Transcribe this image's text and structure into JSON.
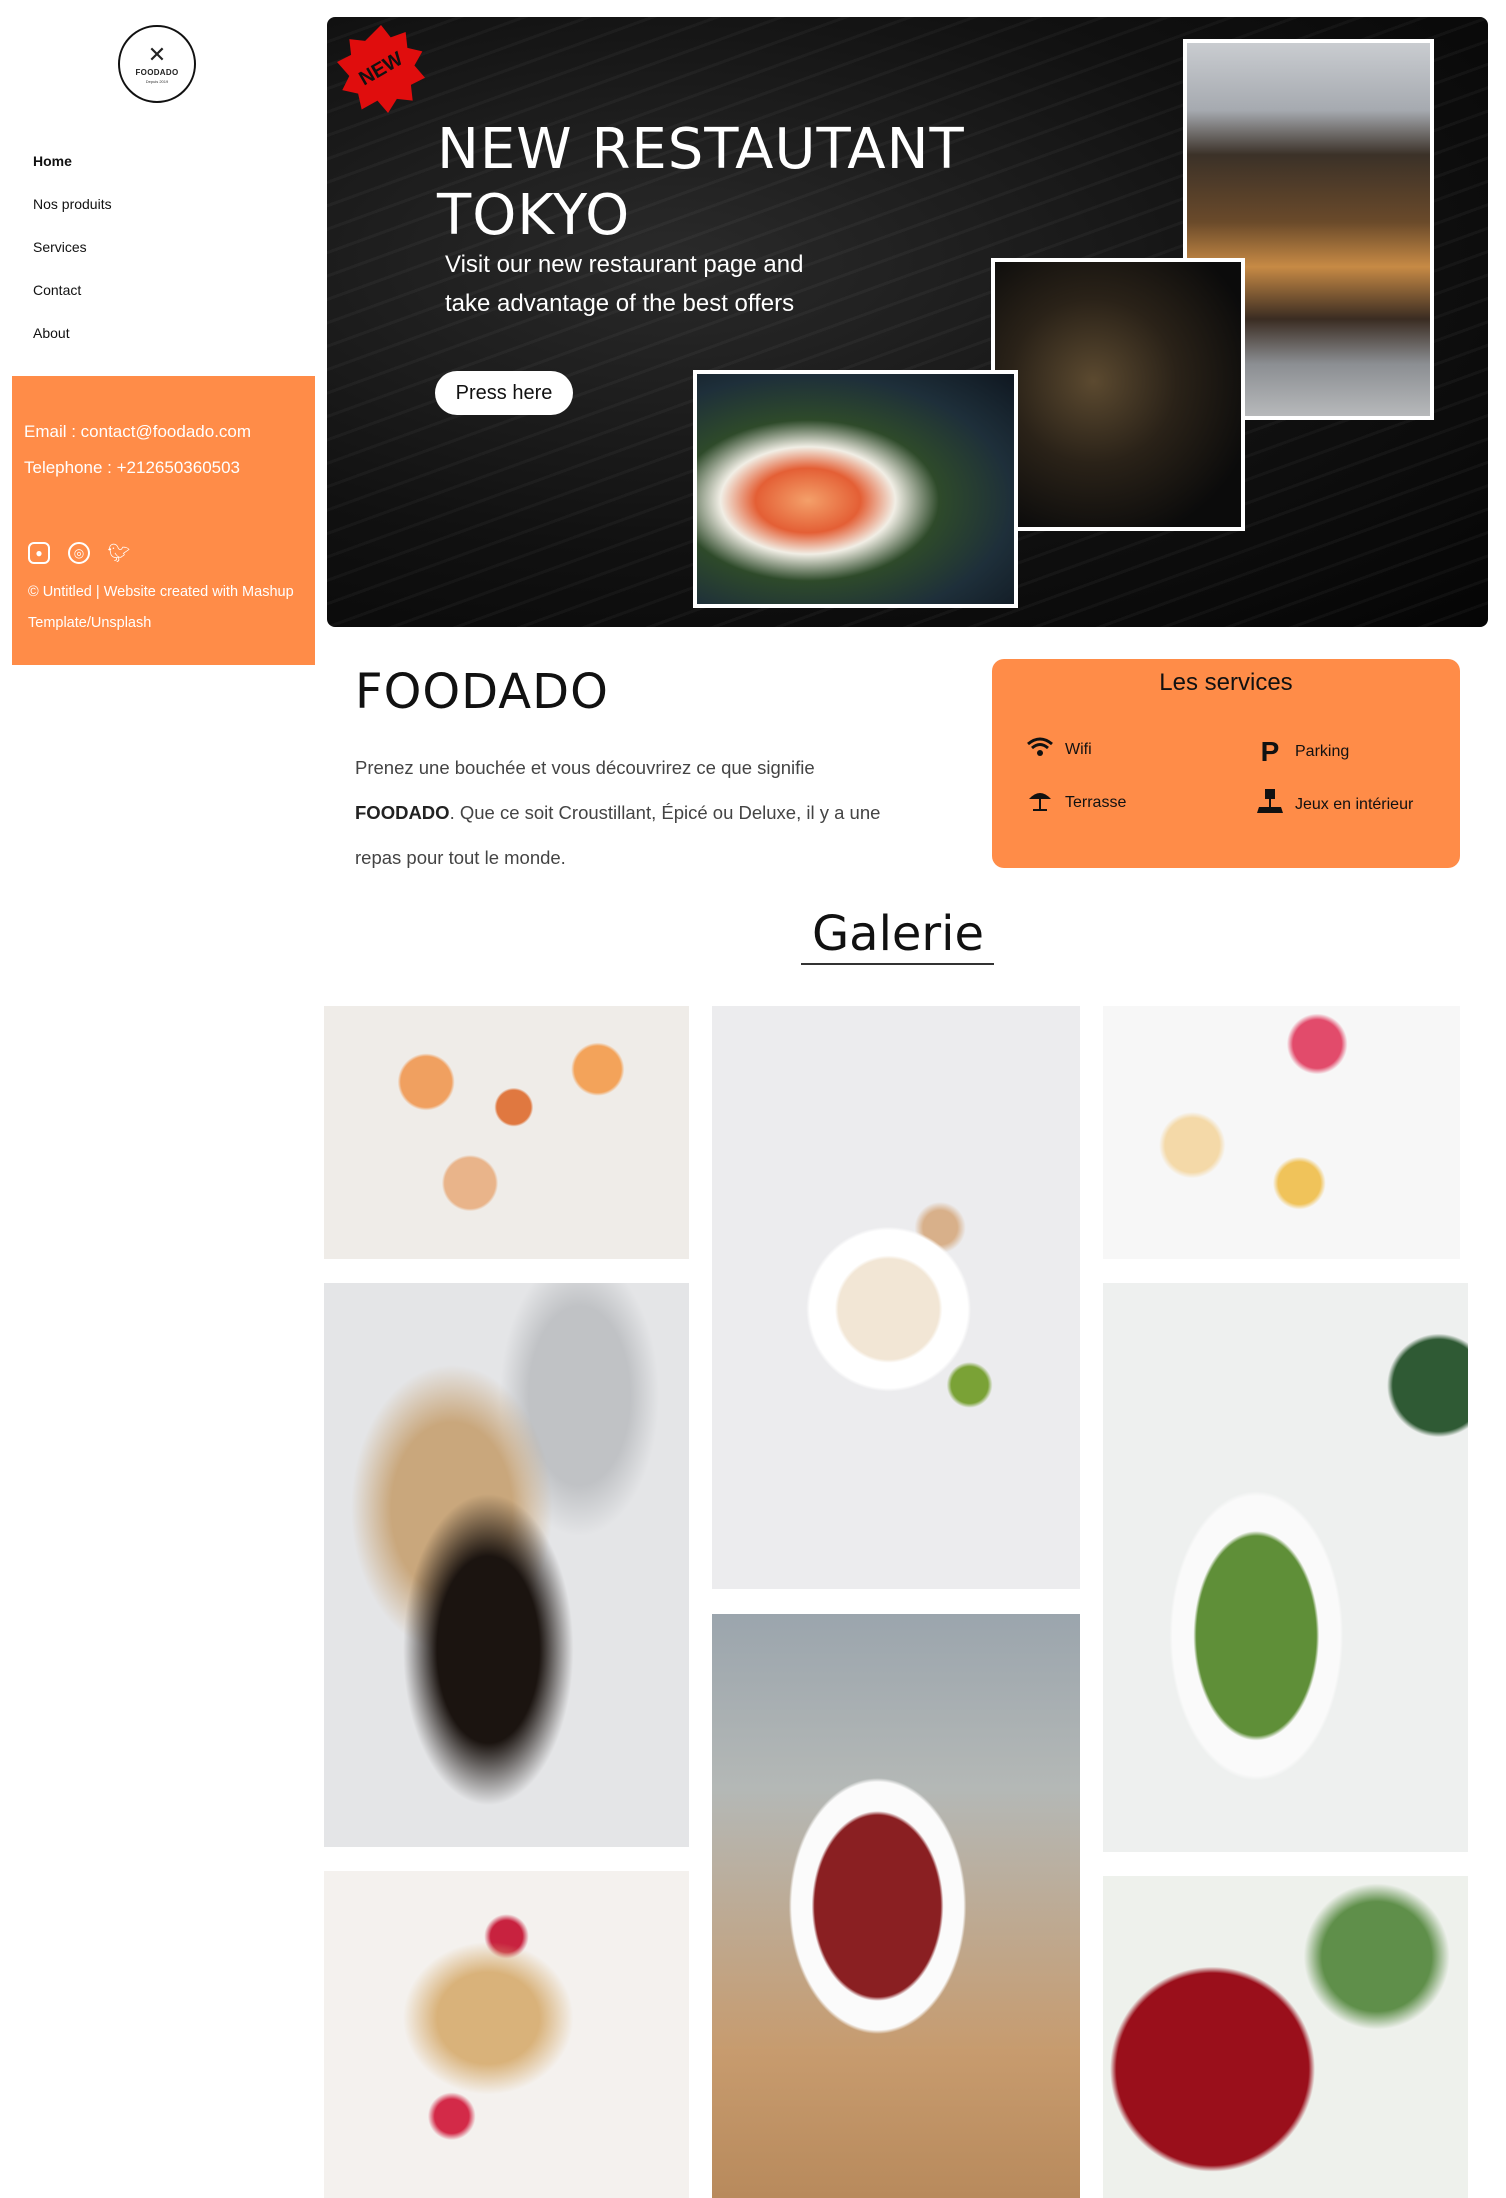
{
  "sidebar": {
    "logo": {
      "brand": "FOODADO",
      "since": "Depuis 2019",
      "icon": "fork-knife-icon"
    },
    "nav": [
      {
        "label": "Home",
        "active": true
      },
      {
        "label": "Nos produits",
        "active": false
      },
      {
        "label": "Services",
        "active": false
      },
      {
        "label": "Contact",
        "active": false
      },
      {
        "label": "About",
        "active": false
      }
    ],
    "contact": {
      "email": "Email : contact@foodado.com",
      "phone": "Telephone : +212650360503"
    },
    "social": [
      "instagram-icon",
      "dribbble-icon",
      "twitter-icon"
    ],
    "footer": "© Untitled | Website created with Mashup Template/Unsplash"
  },
  "hero": {
    "badge": "NEW",
    "title": "NEW RESTAUTANT TOKYO",
    "subtitle": "Visit our new restaurant page and take advantage of the best offers",
    "button": "Press here"
  },
  "about": {
    "title": "FOODADO",
    "desc_before": "Prenez une bouchée et vous découvrirez ce que signifie",
    "desc_bold": "FOODADO",
    "desc_after": ". Que ce soit Croustillant, Épicé ou Deluxe, il y a une repas pour tout le monde."
  },
  "services": {
    "title": "Les services",
    "items": [
      {
        "label": "Wifi",
        "icon": "wifi-icon"
      },
      {
        "label": "Parking",
        "icon": "parking-icon"
      },
      {
        "label": "Terrasse",
        "icon": "umbrella-icon"
      },
      {
        "label": "Jeux en intérieur",
        "icon": "indoor-games-icon"
      }
    ]
  },
  "gallery": {
    "title": "Galerie"
  },
  "colors": {
    "accent": "#ff8c48",
    "badge": "#e00d0d",
    "hero_bg": "#111111"
  }
}
